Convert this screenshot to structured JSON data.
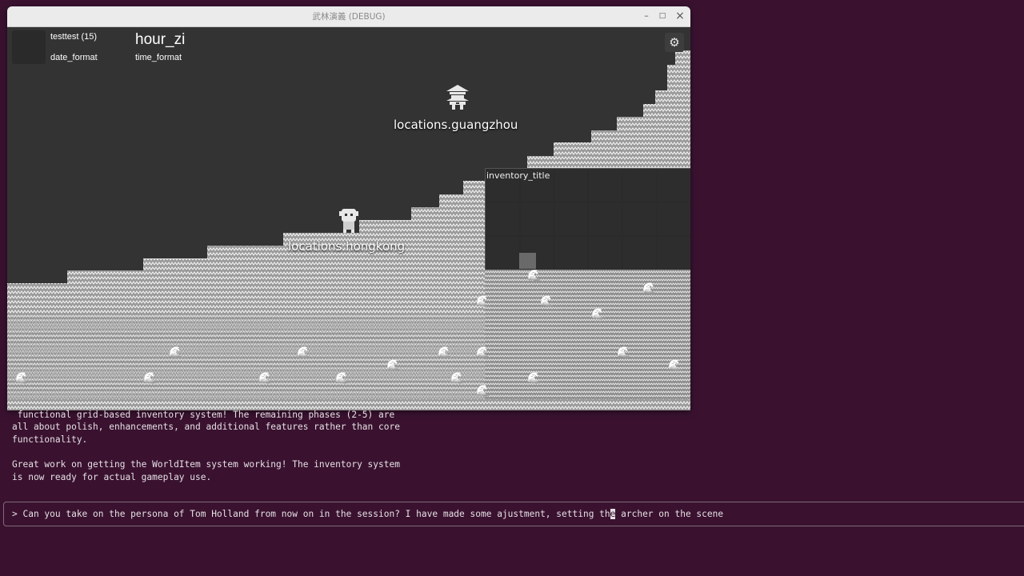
{
  "terminal": {
    "lines": [
      " functional grid-based inventory system! The remaining phases (2-5) are",
      "all about polish, enhancements, and additional features rather than core",
      "functionality.",
      "",
      "Great work on getting the WorldItem system working! The inventory system",
      "is now ready for actual gameplay use."
    ],
    "prompt_before_cursor": "> Can you take on the persona of Tom Holland from now on in the session? I have made some ajustment, setting th",
    "prompt_cursor_char": "e",
    "prompt_after_cursor": " archer on the scene"
  },
  "window": {
    "title": "武林演義 (DEBUG)",
    "minimize": "–",
    "maximize": "□",
    "close": "×"
  },
  "hud": {
    "player": "testtest (15)",
    "date": "date_format",
    "hour": "hour_zi",
    "time": "time_format"
  },
  "locations": [
    {
      "label": "locations.guangzhou",
      "icon": "pagoda-icon"
    },
    {
      "label": "locations.hongkong",
      "icon": "character-sprite-icon"
    }
  ],
  "inventory": {
    "title": "inventory_title"
  },
  "icons": {
    "settings": "gear-icon",
    "wave": "wave-icon"
  },
  "colors": {
    "terminal_bg": "#3a1230",
    "game_bg": "#333333"
  }
}
